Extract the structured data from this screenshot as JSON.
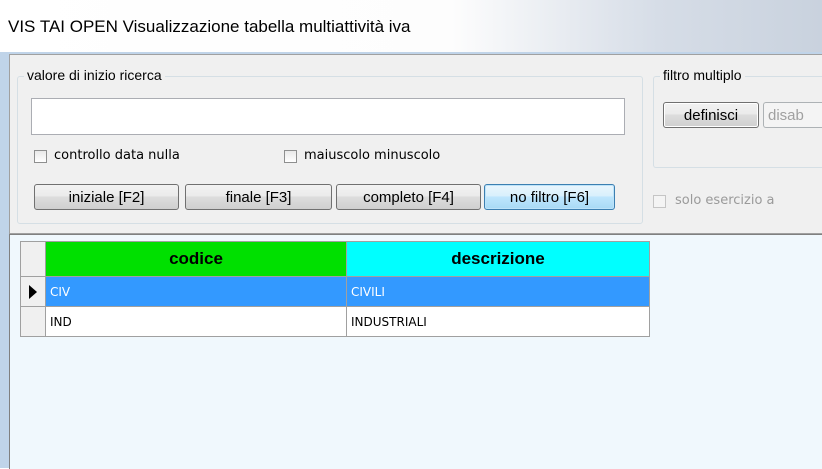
{
  "window": {
    "title": "VIS TAI OPEN  Visualizzazione tabella multiattività iva"
  },
  "search": {
    "group_label": "valore di inizio ricerca",
    "value": "",
    "checkbox_null_date": "controllo data nulla",
    "checkbox_case": "maiuscolo minuscolo",
    "buttons": {
      "initial": "iniziale [F2]",
      "final": "finale [F3]",
      "complete": "completo [F4]",
      "no_filter": "no filtro [F6]"
    }
  },
  "filter": {
    "group_label": "filtro multiplo",
    "define_label": "definisci",
    "disable_label": "disab",
    "exercise_checkbox": "solo esercizio a"
  },
  "table": {
    "columns": [
      "codice",
      "descrizione"
    ],
    "rows": [
      {
        "codice": "CIV",
        "descrizione": "CIVILI",
        "selected": true
      },
      {
        "codice": "IND",
        "descrizione": "INDUSTRIALI",
        "selected": false
      }
    ]
  }
}
